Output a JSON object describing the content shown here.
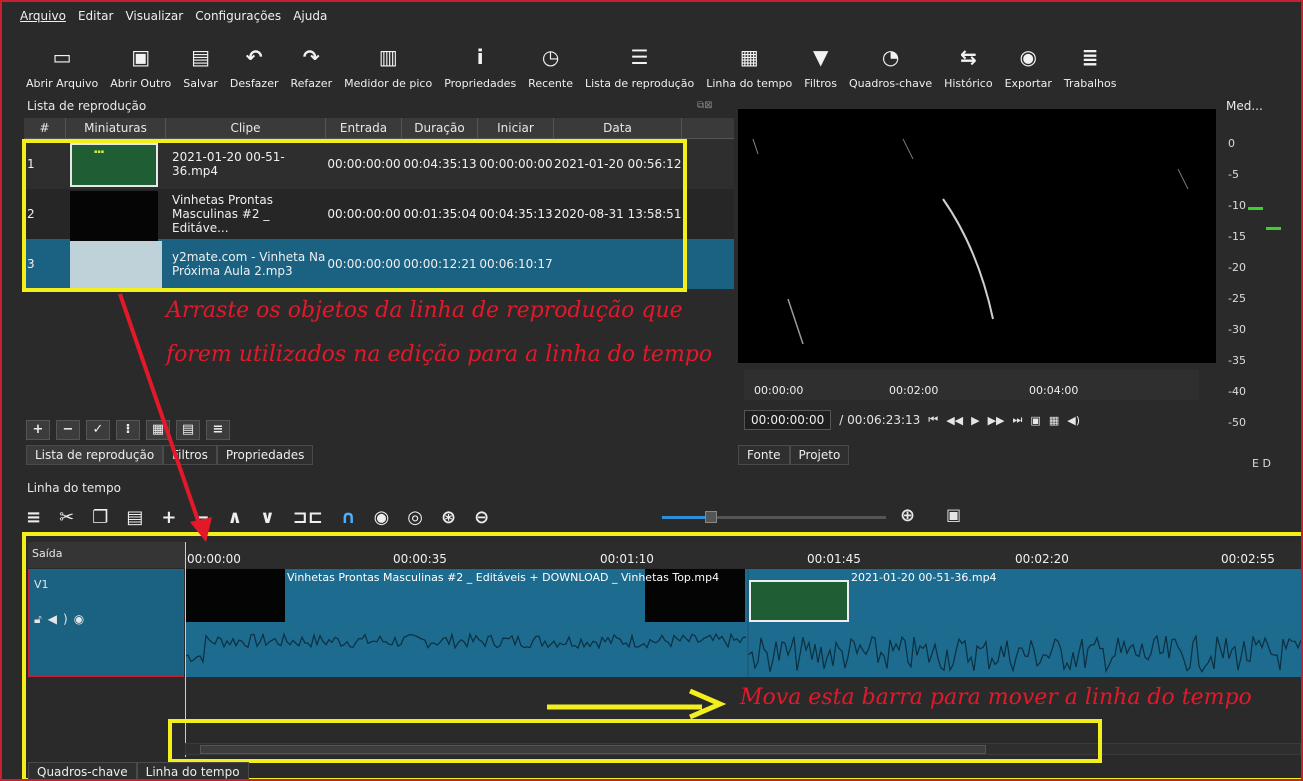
{
  "menu": [
    "Arquivo",
    "Editar",
    "Visualizar",
    "Configurações",
    "Ajuda"
  ],
  "toolbar": [
    {
      "label": "Abrir Arquivo",
      "icon": "folder-open-icon",
      "glyph": "▭"
    },
    {
      "label": "Abrir Outro",
      "icon": "open-other-icon",
      "glyph": "▣"
    },
    {
      "label": "Salvar",
      "icon": "save-icon",
      "glyph": "▤"
    },
    {
      "label": "Desfazer",
      "icon": "undo-icon",
      "glyph": "↶"
    },
    {
      "label": "Refazer",
      "icon": "redo-icon",
      "glyph": "↷"
    },
    {
      "label": "Medidor de pico",
      "icon": "peak-meter-icon",
      "glyph": "▥"
    },
    {
      "label": "Propriedades",
      "icon": "info-icon",
      "glyph": "i"
    },
    {
      "label": "Recente",
      "icon": "clock-icon",
      "glyph": "◷"
    },
    {
      "label": "Lista de reprodução",
      "icon": "playlist-icon",
      "glyph": "☰"
    },
    {
      "label": "Linha do tempo",
      "icon": "timeline-icon",
      "glyph": "▦"
    },
    {
      "label": "Filtros",
      "icon": "filter-icon",
      "glyph": "▼"
    },
    {
      "label": "Quadros-chave",
      "icon": "stopwatch-icon",
      "glyph": "◔"
    },
    {
      "label": "Histórico",
      "icon": "history-icon",
      "glyph": "⇆"
    },
    {
      "label": "Exportar",
      "icon": "export-icon",
      "glyph": "◉"
    },
    {
      "label": "Trabalhos",
      "icon": "jobs-icon",
      "glyph": "≣"
    }
  ],
  "playlist": {
    "title": "Lista de reprodução",
    "columns": [
      "#",
      "Miniaturas",
      "Clipe",
      "Entrada",
      "Duração",
      "Iniciar",
      "Data"
    ],
    "rows": [
      {
        "num": "1",
        "clip": "2021-01-20 00-51-36.mp4",
        "entrada": "00:00:00:00",
        "duracao": "00:04:35:13",
        "iniciar": "00:00:00:00",
        "data": "2021-01-20 00:56:12"
      },
      {
        "num": "2",
        "clip": "Vinhetas Prontas Masculinas #2 _ Editáve...",
        "entrada": "00:00:00:00",
        "duracao": "00:01:35:04",
        "iniciar": "00:04:35:13",
        "data": "2020-08-31 13:58:51"
      },
      {
        "num": "3",
        "clip": "y2mate.com - Vinheta Na Próxima Aula 2.mp3",
        "entrada": "00:00:00:00",
        "duracao": "00:00:12:21",
        "iniciar": "00:06:10:17",
        "data": ""
      }
    ],
    "tabs": [
      "Lista de reprodução",
      "Filtros",
      "Propriedades"
    ],
    "buttons": [
      "+",
      "−",
      "✓",
      "⁝",
      "▦",
      "▤",
      "≡"
    ]
  },
  "annotations": {
    "playlist_note_1": "Arraste os objetos da linha de reprodução que",
    "playlist_note_2": "forem utilizados na edição para a linha do tempo",
    "scroll_note": "Mova esta barra para mover a linha do tempo",
    "color": "#e3192a",
    "box_color": "#f3ef1c"
  },
  "player": {
    "ruler_labels": [
      "00:00:00",
      "00:02:00",
      "00:04:00"
    ],
    "timecode": "00:00:00:00",
    "total": "/ 00:06:23:13",
    "tabs": [
      "Fonte",
      "Projeto"
    ]
  },
  "meter": {
    "title": "Med...",
    "scale": [
      "0",
      "-5",
      "-10",
      "-15",
      "-20",
      "-25",
      "-30",
      "-35",
      "-40",
      "-50"
    ],
    "channels": "E  D"
  },
  "timeline": {
    "title": "Linha do tempo",
    "output_label": "Saída",
    "track_name": "V1",
    "ruler": [
      "00:00:00",
      "00:00:35",
      "00:01:10",
      "00:01:45",
      "00:02:20",
      "00:02:55"
    ],
    "clip_a": "Vinhetas Prontas Masculinas #2 _ Editáveis + DOWNLOAD _ Vinhetas Top.mp4",
    "clip_b": "2021-01-20 00-51-36.mp4",
    "bottom_tabs": [
      "Quadros-chave",
      "Linha do tempo"
    ]
  },
  "colors": {
    "selection": "#1b6182",
    "clip": "#1d6b8e",
    "accent": "#2f8fd8",
    "meter_peak": "#3ad12a"
  }
}
